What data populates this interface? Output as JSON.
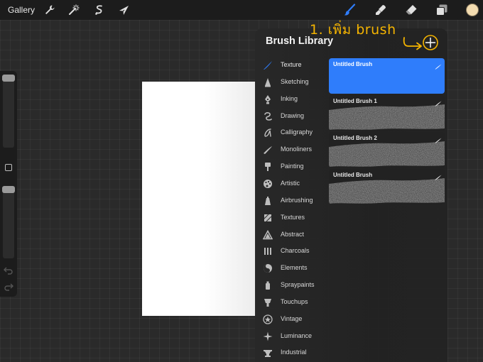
{
  "topbar": {
    "gallery_label": "Gallery",
    "icons": [
      "wrench-icon",
      "magic-wand-icon",
      "selection-icon",
      "transform-arrow-icon",
      "brush-icon",
      "smudge-icon",
      "eraser-icon",
      "layers-icon"
    ],
    "current_color": "#f3dcb0",
    "active_tool_color": "#2f7dfb"
  },
  "brush_library": {
    "title": "Brush Library",
    "categories": [
      {
        "label": "Texture",
        "icon": "texture-stroke-icon",
        "active": true
      },
      {
        "label": "Sketching",
        "icon": "pencil-tip-icon"
      },
      {
        "label": "Inking",
        "icon": "pen-nib-icon"
      },
      {
        "label": "Drawing",
        "icon": "swirl-icon"
      },
      {
        "label": "Calligraphy",
        "icon": "calligraphy-icon"
      },
      {
        "label": "Monoliners",
        "icon": "monoline-stroke-icon"
      },
      {
        "label": "Painting",
        "icon": "paintbrush-icon"
      },
      {
        "label": "Artistic",
        "icon": "palette-icon"
      },
      {
        "label": "Airbrushing",
        "icon": "airbrush-icon"
      },
      {
        "label": "Textures",
        "icon": "texture-square-icon"
      },
      {
        "label": "Abstract",
        "icon": "triangle-icon"
      },
      {
        "label": "Charcoals",
        "icon": "charcoal-icon"
      },
      {
        "label": "Elements",
        "icon": "yin-yang-icon"
      },
      {
        "label": "Spraypaints",
        "icon": "spray-can-icon"
      },
      {
        "label": "Touchups",
        "icon": "touchup-icon"
      },
      {
        "label": "Vintage",
        "icon": "star-badge-icon"
      },
      {
        "label": "Luminance",
        "icon": "sparkle-icon"
      },
      {
        "label": "Industrial",
        "icon": "anvil-icon"
      }
    ],
    "brushes": [
      {
        "name": "Untitled Brush",
        "selected": true
      },
      {
        "name": "Untitled Brush 1"
      },
      {
        "name": "Untitled Brush 2"
      },
      {
        "name": "Untitled Brush"
      }
    ]
  },
  "annotation": {
    "text": "1. เพิ่ม brush",
    "color": "#f5b400"
  }
}
